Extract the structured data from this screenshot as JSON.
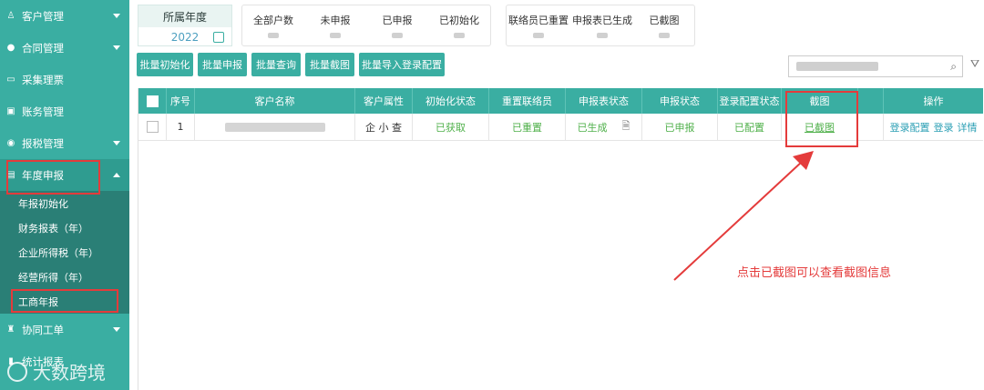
{
  "sidebar": {
    "items": [
      {
        "label": "客户管理",
        "icon": "user-icon"
      },
      {
        "label": "合同管理",
        "icon": "person-icon"
      },
      {
        "label": "采集理票",
        "icon": "card-icon"
      },
      {
        "label": "账务管理",
        "icon": "book-icon"
      },
      {
        "label": "报税管理",
        "icon": "tax-icon"
      },
      {
        "label": "年度申报",
        "icon": "report-icon"
      }
    ],
    "subitems": [
      "年报初始化",
      "财务报表（年）",
      "企业所得税（年）",
      "经营所得（年）",
      "工商年报"
    ],
    "after": [
      {
        "label": "协同工单",
        "icon": "workflow-icon"
      },
      {
        "label": "统计报表",
        "icon": "chart-icon"
      }
    ],
    "watermark": "大数跨境"
  },
  "filters": {
    "year_label": "所属年度",
    "year_value": "2022"
  },
  "stats_a": [
    "全部户数",
    "未申报",
    "已申报",
    "已初始化"
  ],
  "stats_b": [
    "联络员已重置",
    "申报表已生成",
    "已截图"
  ],
  "buttons": [
    "批量初始化",
    "批量申报",
    "批量查询",
    "批量截图",
    "批量导入登录配置"
  ],
  "table": {
    "headers": [
      "序号",
      "客户名称",
      "客户属性",
      "初始化状态",
      "重置联络员",
      "申报表状态",
      "申报状态",
      "登录配置状态",
      "截图",
      "操作"
    ],
    "row": {
      "index": "1",
      "attrs": "企 小 查",
      "init_status": "已获取",
      "reset_status": "已重置",
      "form_status": "已生成",
      "declare_status": "已申报",
      "login_status": "已配置",
      "screenshot": "已截图",
      "ops": [
        "登录配置",
        "登录",
        "详情"
      ]
    }
  },
  "annotation": {
    "text": "点击已截图可以查看截图信息",
    "color": "#e43b3b"
  },
  "colors": {
    "accent": "#3aaea2",
    "green": "#4fb04a",
    "link": "#2b9fb4"
  }
}
